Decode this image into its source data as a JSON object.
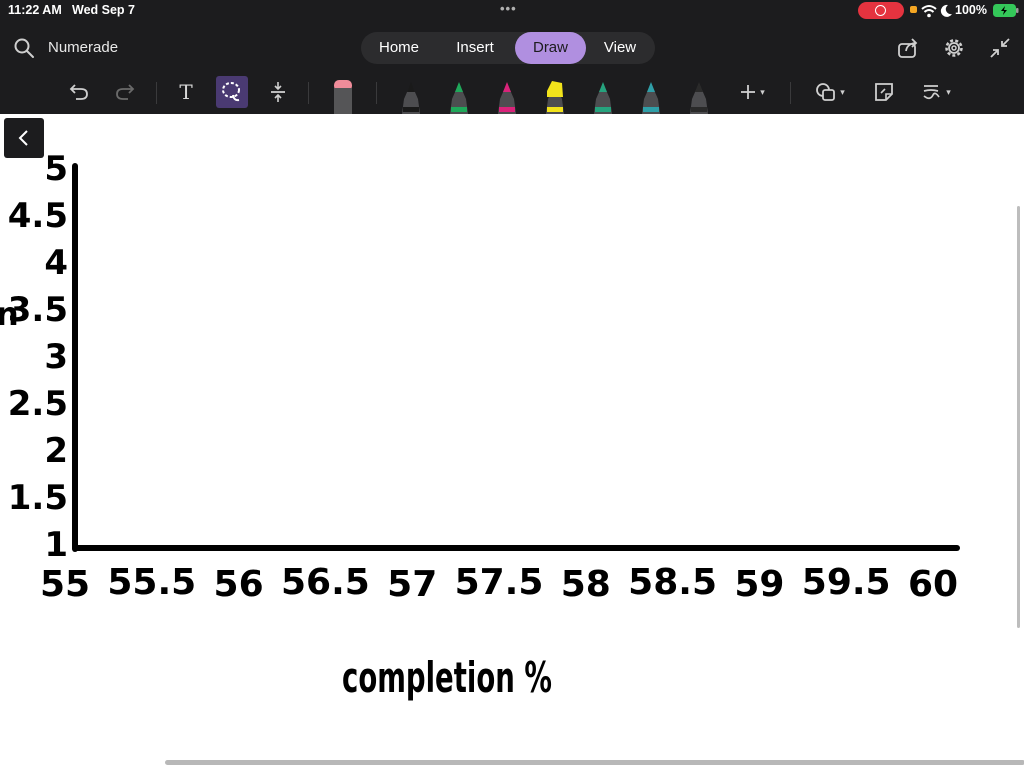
{
  "status_bar": {
    "time": "11:22 AM",
    "date": "Wed Sep 7",
    "battery": "100%",
    "icons": [
      "record-icon",
      "wifi-icon",
      "moon-icon",
      "battery-charging-icon"
    ]
  },
  "header": {
    "app_name": "Numerade",
    "tabs": [
      {
        "label": "Home",
        "active": false
      },
      {
        "label": "Insert",
        "active": false
      },
      {
        "label": "Draw",
        "active": true
      },
      {
        "label": "View",
        "active": false
      }
    ],
    "right_icons": [
      "share-icon",
      "settings-icon",
      "collapse-icon"
    ]
  },
  "toolbar": {
    "undo_icon": "undo-icon",
    "redo_icon": "redo-icon",
    "text_tool": "T",
    "selected_tool": "lasso-select",
    "tools": [
      "text-tool-icon",
      "lasso-select-icon",
      "insert-space-icon",
      "eraser-icon",
      "add-pen-icon",
      "shapes-icon",
      "sticky-note-icon",
      "ink-to-text-icon"
    ],
    "pens": [
      {
        "name": "pen-black",
        "color": "#1a1a1a"
      },
      {
        "name": "pen-green",
        "color": "#1fa85a"
      },
      {
        "name": "pen-magenta",
        "color": "#d9237a"
      },
      {
        "name": "highlighter-yellow",
        "color": "#f2e31b"
      },
      {
        "name": "pen-teal-green",
        "color": "#26a37e"
      },
      {
        "name": "pen-teal",
        "color": "#2f9fa8"
      },
      {
        "name": "pen-dark",
        "color": "#2a2a2a"
      }
    ],
    "accent": "#b08fe0"
  },
  "canvas": {
    "partial_left_letter": "n",
    "xlabel": "completion %"
  },
  "chart_data": {
    "type": "scatter",
    "title": "",
    "xlabel": "completion %",
    "ylabel": "",
    "xlim": [
      55,
      60
    ],
    "ylim": [
      1,
      5
    ],
    "x_ticks": [
      "55",
      "55.5",
      "56",
      "56.5",
      "57",
      "57.5",
      "58",
      "58.5",
      "59",
      "59.5",
      "60"
    ],
    "y_ticks": [
      "1",
      "1.5",
      "2",
      "2.5",
      "3",
      "3.5",
      "4",
      "4.5",
      "5"
    ],
    "series": [],
    "grid": false
  }
}
